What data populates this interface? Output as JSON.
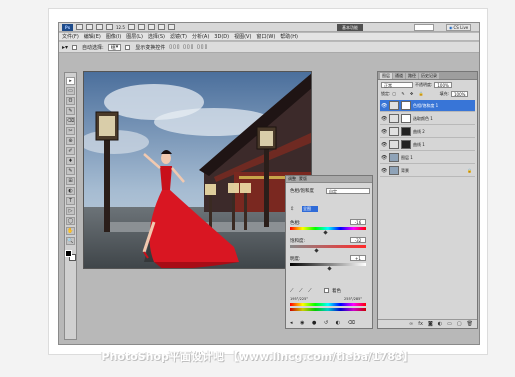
{
  "app": {
    "logo": "Ps",
    "zoom": "12.5",
    "essentials_label": "基本功能",
    "cslive_label": "CS Live"
  },
  "menu": [
    "文件(F)",
    "编辑(E)",
    "图像(I)",
    "图层(L)",
    "选择(S)",
    "滤镜(T)",
    "分析(A)",
    "3D(D)",
    "视图(V)",
    "窗口(W)",
    "帮助(H)"
  ],
  "options_bar": {
    "auto_select_label": "自动选择:",
    "auto_select_value": "组",
    "show_transform_label": "显示变换控件"
  },
  "tools": [
    "▸",
    "▭",
    "ʘ",
    "✎",
    "⌫",
    "✂",
    "⊕",
    "✐",
    "♦",
    "✎",
    "⊞",
    "◐",
    "T",
    "▷",
    "◯",
    "✋",
    "🔍"
  ],
  "adjustments_panel": {
    "tabs": [
      "调整",
      "蒙版"
    ],
    "preset_label": "色相/饱和度",
    "preset_value": "自定",
    "channel_value": "全图",
    "hue_label": "色相:",
    "hue_value": "-16",
    "saturation_label": "饱和度:",
    "saturation_value": "-32",
    "lightness_label": "明度:",
    "lightness_value": "+1",
    "colorize_label": "着色",
    "range_left": "195°/225°",
    "range_right": "255°/285°",
    "hue_fraction": 0.46,
    "saturation_fraction": 0.34,
    "lightness_fraction": 0.5
  },
  "layers_panel": {
    "tabs": [
      "图层",
      "通道",
      "路径",
      "历史记录"
    ],
    "blend_mode": "正常",
    "opacity_label": "不透明度:",
    "opacity_value": "100%",
    "lock_label": "锁定:",
    "fill_label": "填充:",
    "fill_value": "100%",
    "layers": [
      {
        "name": "色相/饱和度 1",
        "selected": true
      },
      {
        "name": "选取颜色 1",
        "selected": false
      },
      {
        "name": "曲线 2",
        "selected": false
      },
      {
        "name": "曲线 1",
        "selected": false
      },
      {
        "name": "图层 1",
        "selected": false
      },
      {
        "name": "背景",
        "selected": false
      }
    ]
  },
  "watermark": "PhotoShop平面设计吧 【www.lincg.com/tieba/1783】",
  "colors": {
    "selection_blue": "#3875d7",
    "dress_red": "#c8101a",
    "roof_dark": "#2a1a1a"
  }
}
